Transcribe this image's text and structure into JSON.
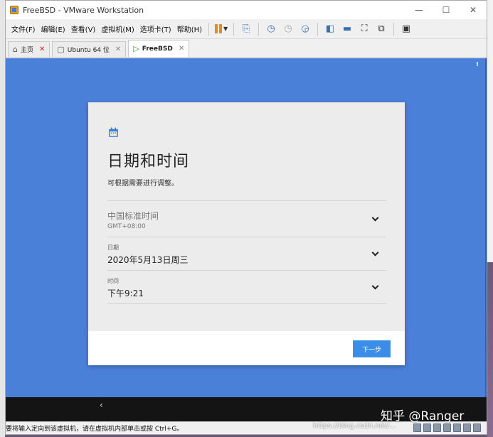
{
  "window": {
    "title": "FreeBSD - VMware Workstation",
    "controls": {
      "minimize": "—",
      "maximize": "☐",
      "close": "✕"
    }
  },
  "menu": {
    "items": [
      "文件(F)",
      "编辑(E)",
      "查看(V)",
      "虚拟机(M)",
      "选项卡(T)",
      "帮助(H)"
    ]
  },
  "toolbar": {
    "icons": [
      "pause-icon",
      "send-keys-icon",
      "snapshot-icon",
      "revert-snapshot-icon",
      "snapshot-manager-icon",
      "sidebar-icon",
      "console-view-icon",
      "fullscreen-icon",
      "unity-icon",
      "library-icon"
    ]
  },
  "tabs": [
    {
      "label": "主页",
      "icon": "home-icon",
      "active": false,
      "close": "✕"
    },
    {
      "label": "Ubuntu 64 位",
      "icon": "vm-icon",
      "active": false,
      "close": "✕"
    },
    {
      "label": "FreeBSD",
      "icon": "vm-running-icon",
      "active": true,
      "close": "✕"
    }
  ],
  "dialog": {
    "title": "日期和时间",
    "subtitle": "可根据需要进行调整。",
    "timezone": {
      "name": "中国标准时间",
      "offset": "GMT+08:00"
    },
    "date": {
      "label": "日期",
      "value": "2020年5月13日周三"
    },
    "time": {
      "label": "时间",
      "value": "下午9:21"
    },
    "next_label": "下一步",
    "accent": "#3c8de8"
  },
  "vm_nav": {
    "back": "‹"
  },
  "statusbar": {
    "text": "要将输入定向到该虚拟机，请在虚拟机内部单击或按 Ctrl+G。"
  },
  "watermark": {
    "main": "知乎 @Ranger",
    "url": "https://blog.csdn.net/..."
  }
}
